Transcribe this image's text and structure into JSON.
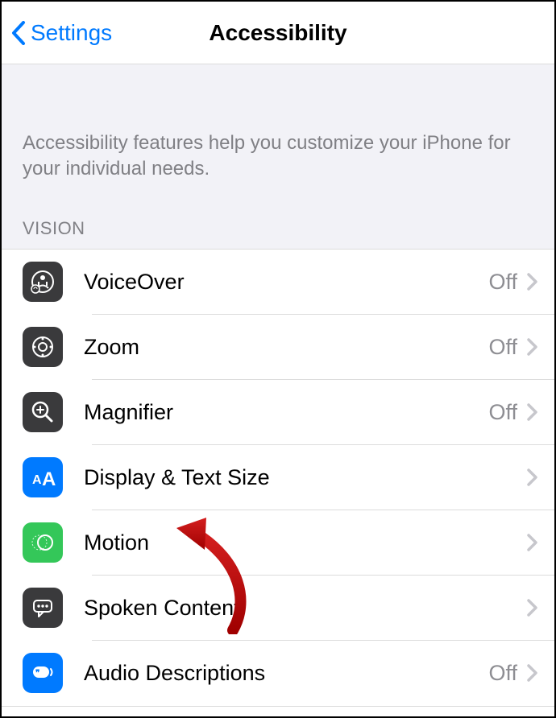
{
  "header": {
    "back_label": "Settings",
    "title": "Accessibility"
  },
  "description": "Accessibility features help you customize your iPhone for your individual needs.",
  "section_header": "VISION",
  "rows": [
    {
      "label": "VoiceOver",
      "value": "Off",
      "icon": "voiceover",
      "bg": "#3a3a3c"
    },
    {
      "label": "Zoom",
      "value": "Off",
      "icon": "zoom",
      "bg": "#3a3a3c"
    },
    {
      "label": "Magnifier",
      "value": "Off",
      "icon": "magnifier",
      "bg": "#3a3a3c"
    },
    {
      "label": "Display & Text Size",
      "value": "",
      "icon": "textsize",
      "bg": "#007aff"
    },
    {
      "label": "Motion",
      "value": "",
      "icon": "motion",
      "bg": "#34c759"
    },
    {
      "label": "Spoken Content",
      "value": "",
      "icon": "spoken",
      "bg": "#3a3a3c"
    },
    {
      "label": "Audio Descriptions",
      "value": "Off",
      "icon": "audiodesc",
      "bg": "#007aff"
    }
  ]
}
